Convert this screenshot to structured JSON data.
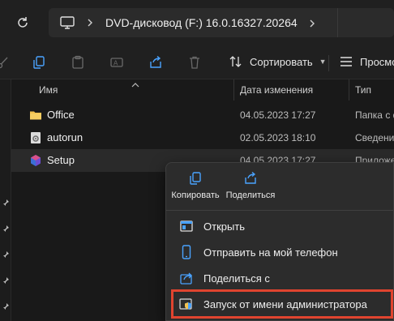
{
  "address": {
    "path": "DVD-дисковод (F:) 16.0.16327.20264"
  },
  "toolbar": {
    "sort_label": "Сортировать",
    "view_label": "Просмо"
  },
  "columns": {
    "name": "Имя",
    "date": "Дата изменения",
    "type": "Тип"
  },
  "files": [
    {
      "icon": "folder-icon",
      "name": "Office",
      "date": "04.05.2023 17:27",
      "type": "Папка с ф"
    },
    {
      "icon": "settings-file-icon",
      "name": "autorun",
      "date": "02.05.2023 18:10",
      "type": "Сведения"
    },
    {
      "icon": "office-setup-icon",
      "name": "Setup",
      "date": "04.05.2023 17:27",
      "type": "Приложе"
    }
  ],
  "context_menu": {
    "quick_actions": [
      {
        "label": "Копировать",
        "icon": "copy-icon"
      },
      {
        "label": "Поделиться",
        "icon": "share-icon"
      }
    ],
    "items": [
      {
        "label": "Открыть",
        "icon": "open-window-icon"
      },
      {
        "label": "Отправить на мой телефон",
        "icon": "phone-icon"
      },
      {
        "label": "Поделиться с",
        "icon": "share-with-icon"
      },
      {
        "label": "Запуск от имени администратора",
        "icon": "admin-shield-icon",
        "highlighted": true
      }
    ]
  },
  "colors": {
    "highlight_outline": "#e0442f",
    "folder": "#f2c14e",
    "accent": "#4aa3ff"
  }
}
